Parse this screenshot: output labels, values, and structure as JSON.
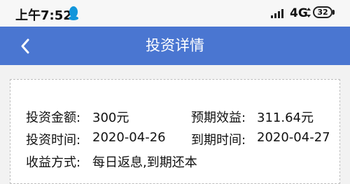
{
  "status_bar": {
    "time": "上午7:52",
    "network": "4G",
    "battery": "32",
    "icons": [
      "qq-icon",
      "signal-icon",
      "network-arrows-icon",
      "battery-icon"
    ]
  },
  "header": {
    "title": "投资详情",
    "back_icon": "chevron-left-icon",
    "color": "#4a76d1"
  },
  "details": {
    "amount_label": "投资金额:",
    "amount_value": "300元",
    "expected_label": "预期效益:",
    "expected_value": "311.64元",
    "invest_time_label": "投资时间:",
    "invest_time_value": "2020-04-26",
    "due_time_label": "到期时间:",
    "due_time_value": "2020-04-27",
    "method_label": "收益方式:",
    "method_value": "每日返息,到期还本"
  }
}
